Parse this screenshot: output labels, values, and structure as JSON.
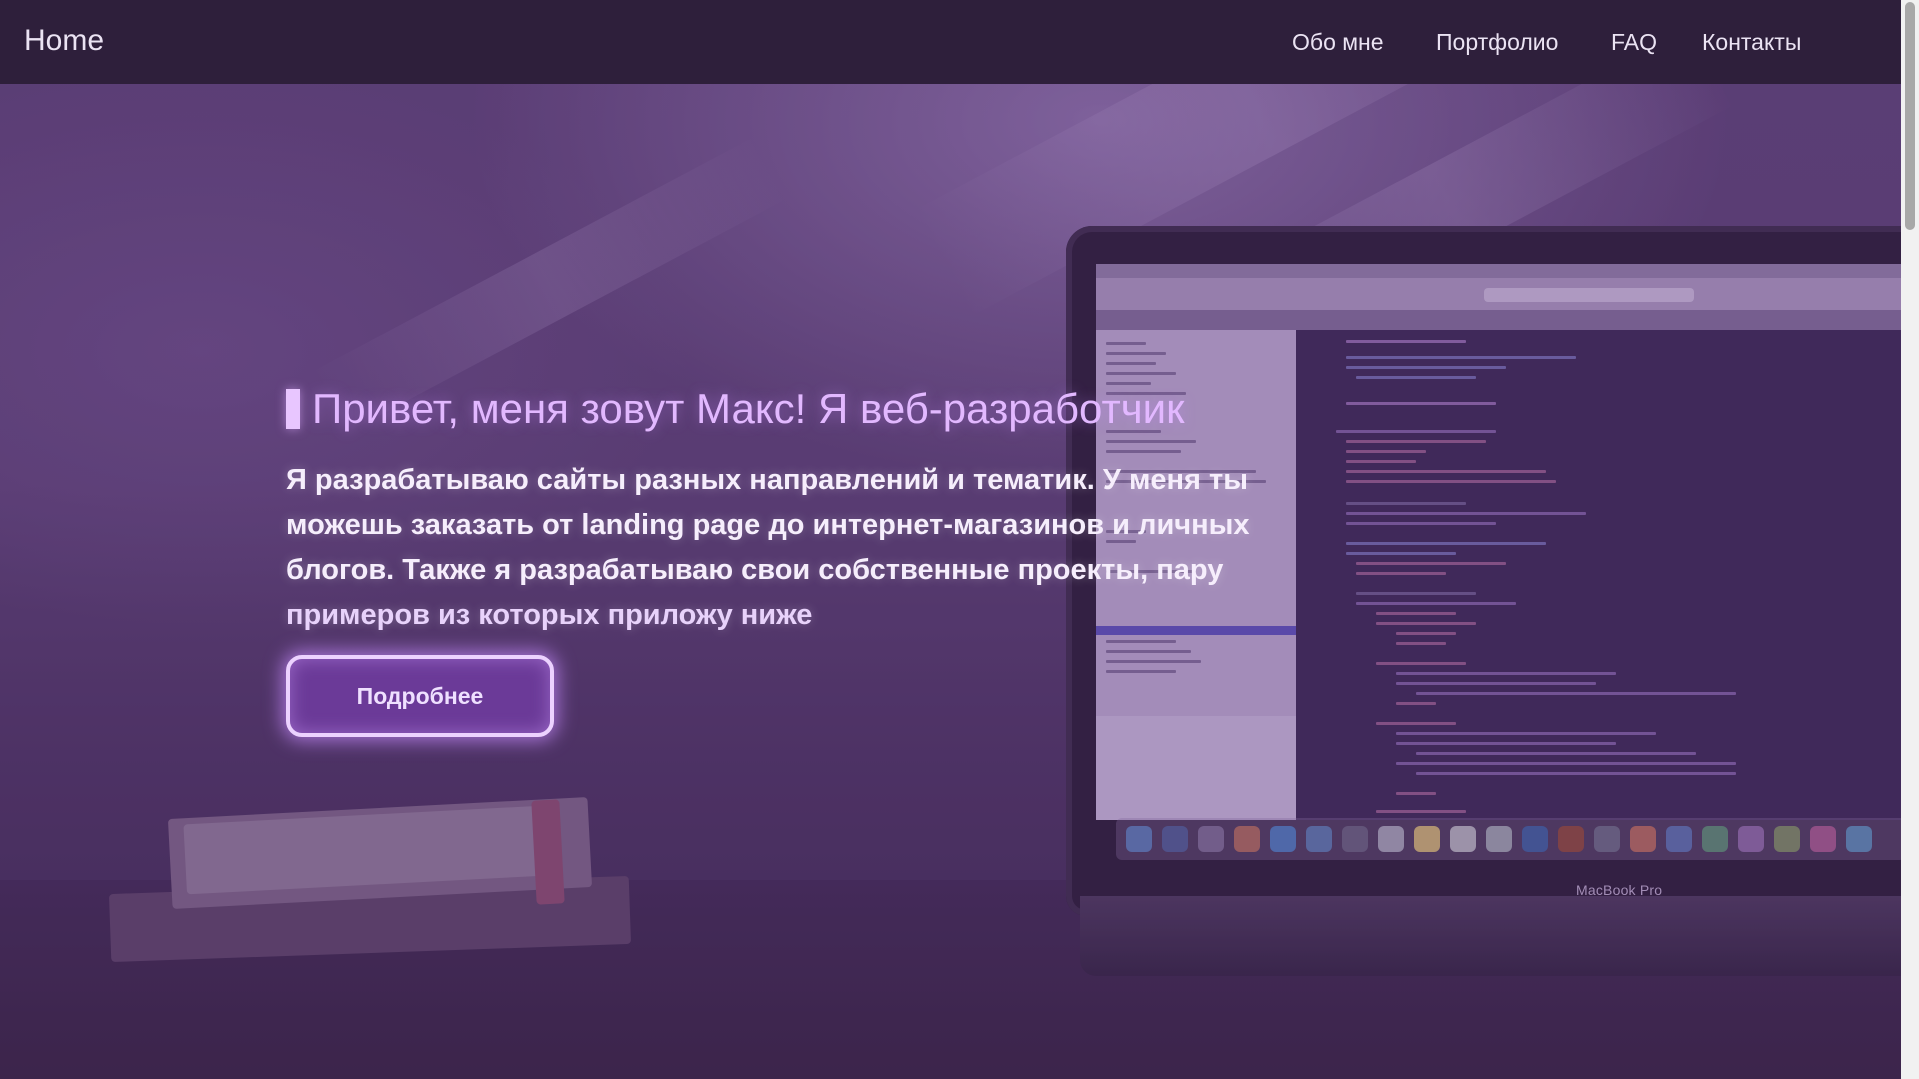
{
  "nav": {
    "brand": "Home",
    "links": [
      "Обо мне",
      "Портфолио",
      "FAQ",
      "Контакты"
    ]
  },
  "hero": {
    "title": "Привет, меня зовут Макс! Я веб-разработчик",
    "text_lines": [
      "Я разрабатываю сайты разных направлений и тематик. У меня ты",
      "можешь заказать от landing page до интернет-магазинов и личных",
      "блогов. Также я разрабатываю свои собственные проекты, пару",
      "примеров из которых приложу ниже"
    ],
    "button_label": "Подробнее"
  },
  "background": {
    "laptop_label": "MacBook Pro"
  },
  "colors": {
    "navbar": "#2e1f3b",
    "accent": "#e2b8ff",
    "button_fill": "#6b3a98",
    "button_glow": "#c88cff"
  }
}
